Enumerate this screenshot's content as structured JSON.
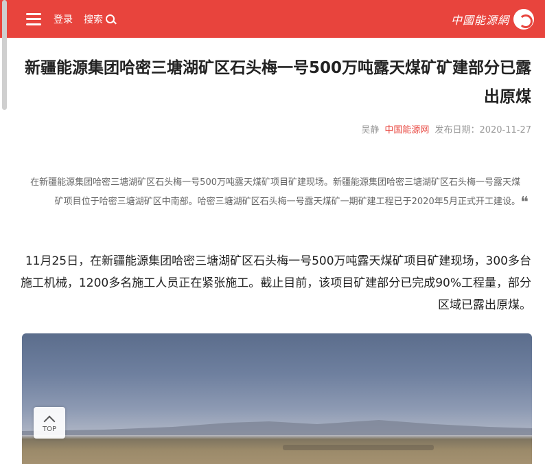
{
  "header": {
    "logo_text": "中國能源網",
    "search_label": "搜索",
    "login_label": "登录"
  },
  "article": {
    "title": "新疆能源集团哈密三塘湖矿区石头梅一号500万吨露天煤矿矿建部分已露出原煤",
    "meta": {
      "date_label": "发布日期：2020-11-27",
      "source": "中国能源网",
      "author": "吴静"
    },
    "summary": "在新疆能源集团哈密三塘湖矿区石头梅一号500万吨露天煤矿项目矿建现场。新疆能源集团哈密三塘湖矿区石头梅一号露天煤矿项目位于哈密三塘湖矿区中南部。哈密三塘湖矿区石头梅一号露天煤矿一期矿建工程已于2020年5月正式开工建设。",
    "body": "11月25日，在新疆能源集团哈密三塘湖矿区石头梅一号500万吨露天煤矿项目矿建现场，300多台施工机械，1200多名施工人员正在紧张施工。截止目前，该项目矿建部分已完成90%工程量，部分区域已露出原煤。"
  },
  "top_button": {
    "label": "TOP"
  },
  "colors": {
    "brand": "#e8443d"
  }
}
